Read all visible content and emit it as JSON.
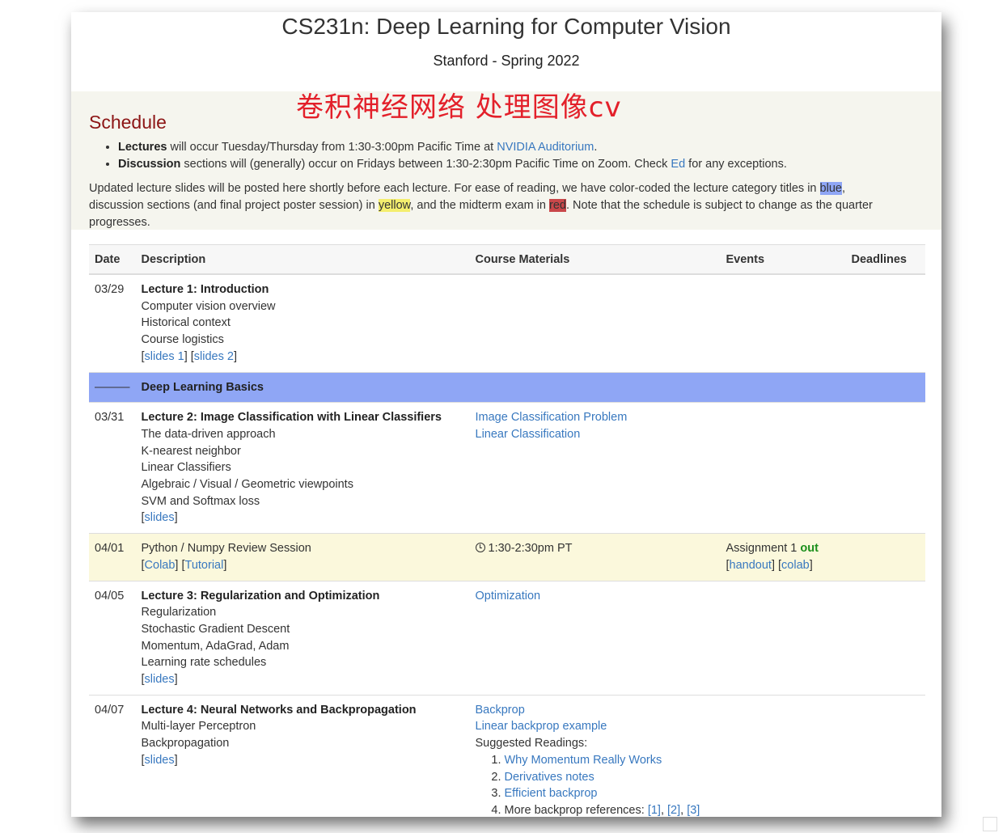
{
  "header": {
    "title": "CS231n: Deep Learning for Computer Vision",
    "subtitle": "Stanford - Spring 2022",
    "overlay_note": "卷积神经网络 处理图像cv"
  },
  "schedule": {
    "heading": "Schedule",
    "bullets": [
      {
        "bold": "Lectures",
        "pre": " will occur Tuesday/Thursday from 1:30-3:00pm Pacific Time at ",
        "link": "NVIDIA Auditorium",
        "post": "."
      },
      {
        "bold": "Discussion",
        "pre": " sections will (generally) occur on Fridays between 1:30-2:30pm Pacific Time on Zoom. Check ",
        "link": "Ed",
        "post": " for any exceptions."
      }
    ],
    "note": {
      "p1": "Updated lecture slides will be posted here shortly before each lecture. For ease of reading, we have color-coded the lecture category titles in ",
      "blue": "blue",
      "p2": ", discussion sections (and final project poster session) in ",
      "yellow": "yellow",
      "p3": ", and the midterm exam in ",
      "red": "red",
      "p4": ". Note that the schedule is subject to change as the quarter progresses."
    }
  },
  "table": {
    "headers": [
      "Date",
      "Description",
      "Course Materials",
      "Events",
      "Deadlines"
    ],
    "rows": {
      "r1": {
        "date": "03/29",
        "title": "Lecture 1: Introduction",
        "topics": [
          "Computer vision overview",
          "Historical context",
          "Course logistics"
        ],
        "links": [
          "slides 1",
          "slides 2"
        ]
      },
      "section": {
        "date": "———",
        "title": "Deep Learning Basics"
      },
      "r2": {
        "date": "03/31",
        "title": "Lecture 2: Image Classification with Linear Classifiers",
        "topics": [
          "The data-driven approach",
          "K-nearest neighbor",
          "Linear Classifiers",
          "Algebraic / Visual / Geometric viewpoints",
          "SVM and Softmax loss"
        ],
        "links": [
          "slides"
        ],
        "materials": [
          "Image Classification Problem",
          "Linear Classification"
        ]
      },
      "r3": {
        "date": "04/01",
        "title": "Python / Numpy Review Session",
        "links": [
          "Colab",
          "Tutorial"
        ],
        "time": "1:30-2:30pm PT",
        "event_pre": "Assignment 1 ",
        "event_out": "out",
        "event_links": [
          "handout",
          "colab"
        ]
      },
      "r4": {
        "date": "04/05",
        "title": "Lecture 3: Regularization and Optimization",
        "topics": [
          "Regularization",
          "Stochastic Gradient Descent",
          "Momentum, AdaGrad, Adam",
          "Learning rate schedules"
        ],
        "links": [
          "slides"
        ],
        "materials": [
          "Optimization"
        ]
      },
      "r5": {
        "date": "04/07",
        "title": "Lecture 4: Neural Networks and Backpropagation",
        "topics": [
          "Multi-layer Perceptron",
          "Backpropagation"
        ],
        "links": [
          "slides"
        ],
        "materials": [
          "Backprop",
          "Linear backprop example"
        ],
        "readings_label": "Suggested Readings:",
        "readings": [
          "Why Momentum Really Works",
          "Derivatives notes",
          "Efficient backprop"
        ],
        "more_refs_label": "More backprop references: ",
        "more_refs": [
          "[1]",
          "[2]",
          "[3]"
        ]
      }
    }
  }
}
